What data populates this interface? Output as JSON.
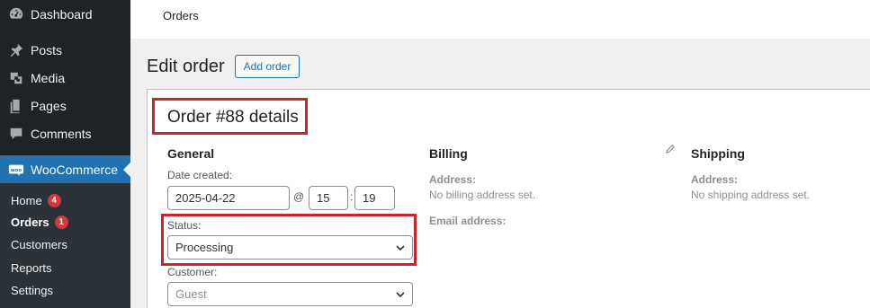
{
  "sidebar": {
    "items": [
      {
        "label": "Dashboard",
        "icon": "dashboard-icon"
      },
      {
        "label": "Posts",
        "icon": "pin-icon"
      },
      {
        "label": "Media",
        "icon": "media-icon"
      },
      {
        "label": "Pages",
        "icon": "pages-icon"
      },
      {
        "label": "Comments",
        "icon": "comment-icon"
      },
      {
        "label": "WooCommerce",
        "icon": "woocommerce-icon"
      }
    ],
    "submenu": [
      {
        "label": "Home",
        "badge": "4"
      },
      {
        "label": "Orders",
        "badge": "1"
      },
      {
        "label": "Customers"
      },
      {
        "label": "Reports"
      },
      {
        "label": "Settings"
      }
    ]
  },
  "topbar": {
    "title": "Orders"
  },
  "heading": {
    "title": "Edit order",
    "add_label": "Add order"
  },
  "order": {
    "title": "Order #88 details"
  },
  "general": {
    "heading": "General",
    "date_label": "Date created:",
    "date": "2025-04-22",
    "at": "@",
    "hour": "15",
    "colon": ":",
    "minute": "19",
    "status_label": "Status:",
    "status": "Processing",
    "customer_label": "Customer:",
    "customer_placeholder": "Guest"
  },
  "billing": {
    "heading": "Billing",
    "address_label": "Address:",
    "address_value": "No billing address set.",
    "email_label": "Email address:"
  },
  "shipping": {
    "heading": "Shipping",
    "address_label": "Address:",
    "address_value": "No shipping address set."
  },
  "colors": {
    "accent": "#2271b1",
    "highlight": "#cc2229",
    "sidebar": "#1d2327",
    "badge": "#d63638"
  }
}
